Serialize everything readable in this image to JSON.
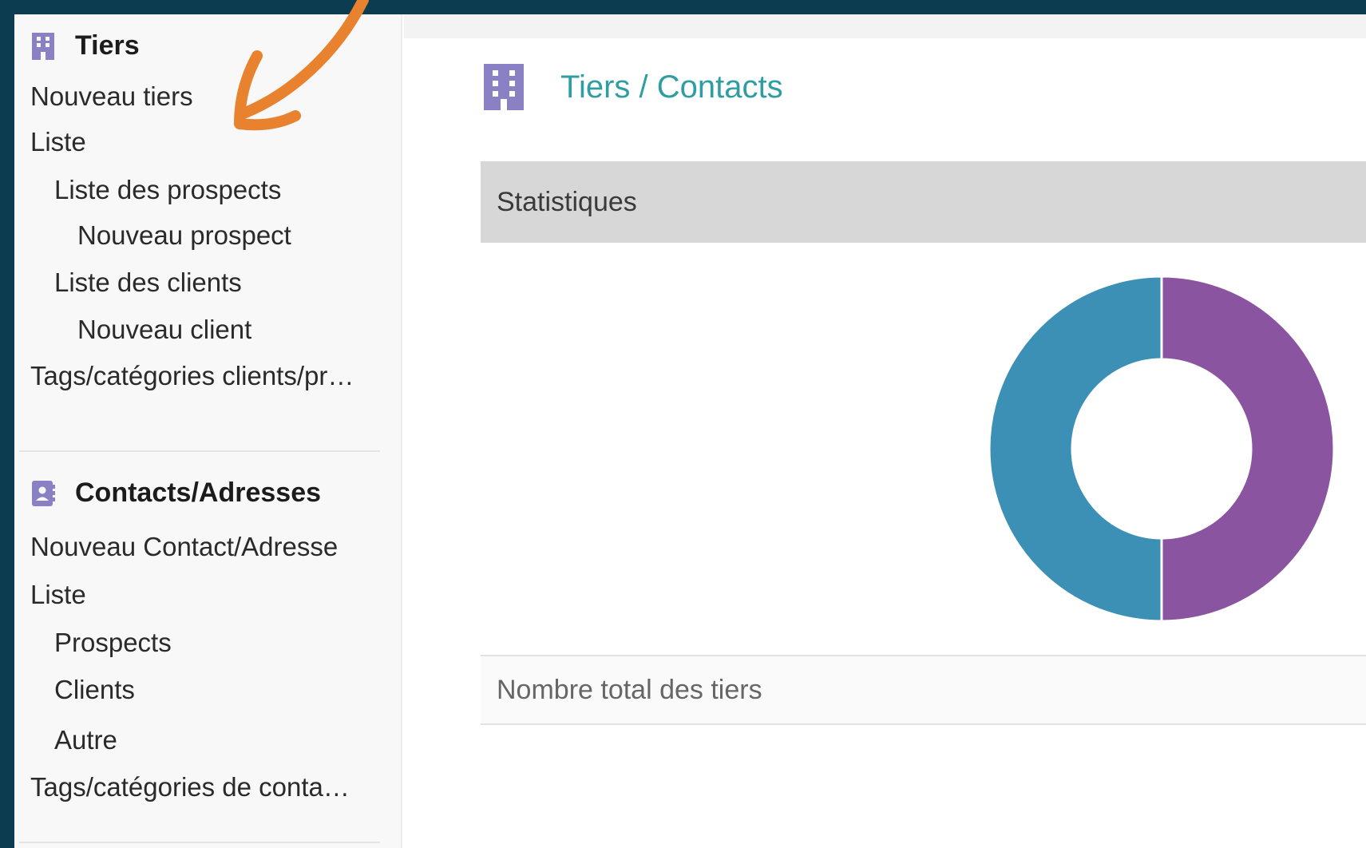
{
  "sidebar": {
    "tiers": {
      "title": "Tiers",
      "items": [
        {
          "label": "Nouveau tiers"
        },
        {
          "label": "Liste"
        },
        {
          "label": "Liste des prospects"
        },
        {
          "label": "Nouveau prospect"
        },
        {
          "label": "Liste des clients"
        },
        {
          "label": "Nouveau client"
        },
        {
          "label": "Tags/catégories clients/pr…"
        }
      ]
    },
    "contacts": {
      "title": "Contacts/Adresses",
      "items": [
        {
          "label": "Nouveau Contact/Adresse"
        },
        {
          "label": "Liste"
        },
        {
          "label": "Prospects"
        },
        {
          "label": "Clients"
        },
        {
          "label": "Autre"
        },
        {
          "label": "Tags/catégories de conta…"
        }
      ]
    }
  },
  "main": {
    "title": "Tiers / Contacts",
    "stats_label": "Statistiques",
    "total_label": "Nombre total des tiers"
  },
  "icons": {
    "tiers": "building-icon",
    "contacts": "address-book-icon",
    "header": "building-icon"
  },
  "colors": {
    "accent": "#2f9ea3",
    "icon": "#8a80c4",
    "frame": "#0b3c4f",
    "annotation_arrow": "#e8822e"
  },
  "chart_data": {
    "type": "pie",
    "donut": true,
    "series": [
      {
        "values": [
          50,
          50
        ],
        "colors": [
          "#8a54a0",
          "#3d90b5"
        ]
      }
    ],
    "title": "",
    "legend": "none"
  }
}
